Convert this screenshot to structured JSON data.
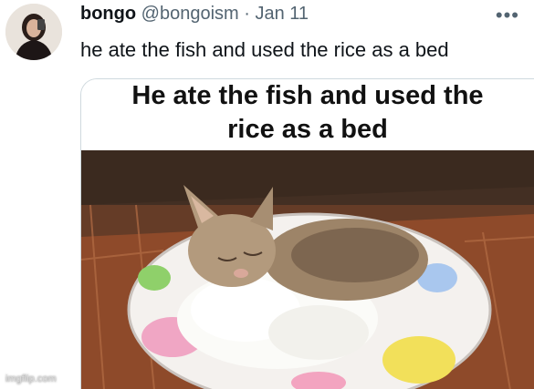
{
  "tweet": {
    "display_name": "bongo",
    "handle": "@bongoism",
    "separator": "·",
    "date": "Jan 11",
    "more_icon": "more-horizontal-icon",
    "text": "he ate the fish and used the rice as a bed"
  },
  "media": {
    "caption_line1": "He ate the fish and used the",
    "caption_line2": "rice as a bed"
  },
  "watermark": "imgflip.com",
  "colors": {
    "text_primary": "#0f1419",
    "text_secondary": "#536471",
    "border": "#cfd9de"
  }
}
